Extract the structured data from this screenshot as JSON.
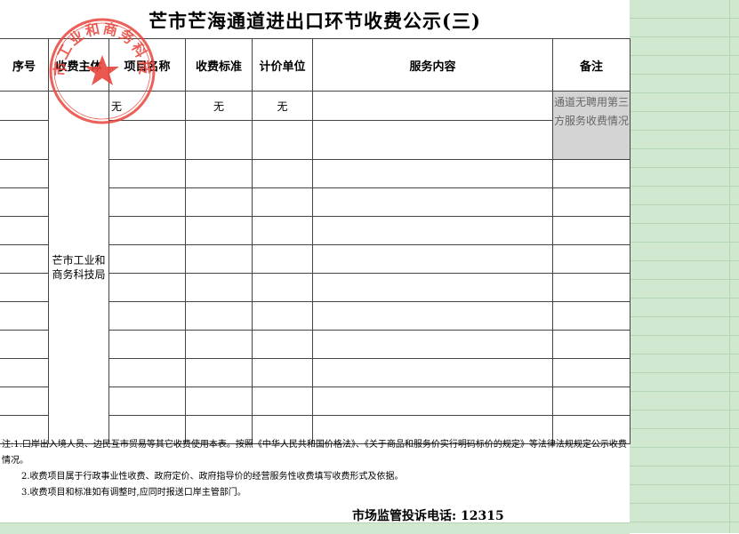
{
  "title": "芒市芒海通道进出口环节收费公示(三)",
  "headers": {
    "seq": "序号",
    "subject": "收费主体",
    "item": "项目名称",
    "standard": "收费标准",
    "unit": "计价单位",
    "service": "服务内容",
    "remark": "备注"
  },
  "row1": {
    "item": "无",
    "standard": "无",
    "unit": "无"
  },
  "subject_value": "芒市工业和商务科技局",
  "remark_value": "通道无聘用第三方服务收费情况",
  "notes": {
    "n1": "注:1.口岸出入境人员、边民互市贸易等其它收费使用本表。按照《中华人民共和国价格法》、《关于商品和服务价实行明码标价的规定》等法律法规规定公示收费情况。",
    "n2": "2.收费项目属于行政事业性收费、政府定价、政府指导价的经营服务性收费填写收费形式及依据。",
    "n3": "3.收费项目和标准如有调整时,应同时报送口岸主管部门。"
  },
  "hotline": "市场监管投诉电话: 12315",
  "seal": {
    "text": "芒市工业和商务科技局",
    "color": "#e8453c"
  },
  "colors": {
    "sheet_green": "#cfe8cf",
    "seal_red": "#e8453c",
    "remark_gray": "#d4d4d4"
  }
}
